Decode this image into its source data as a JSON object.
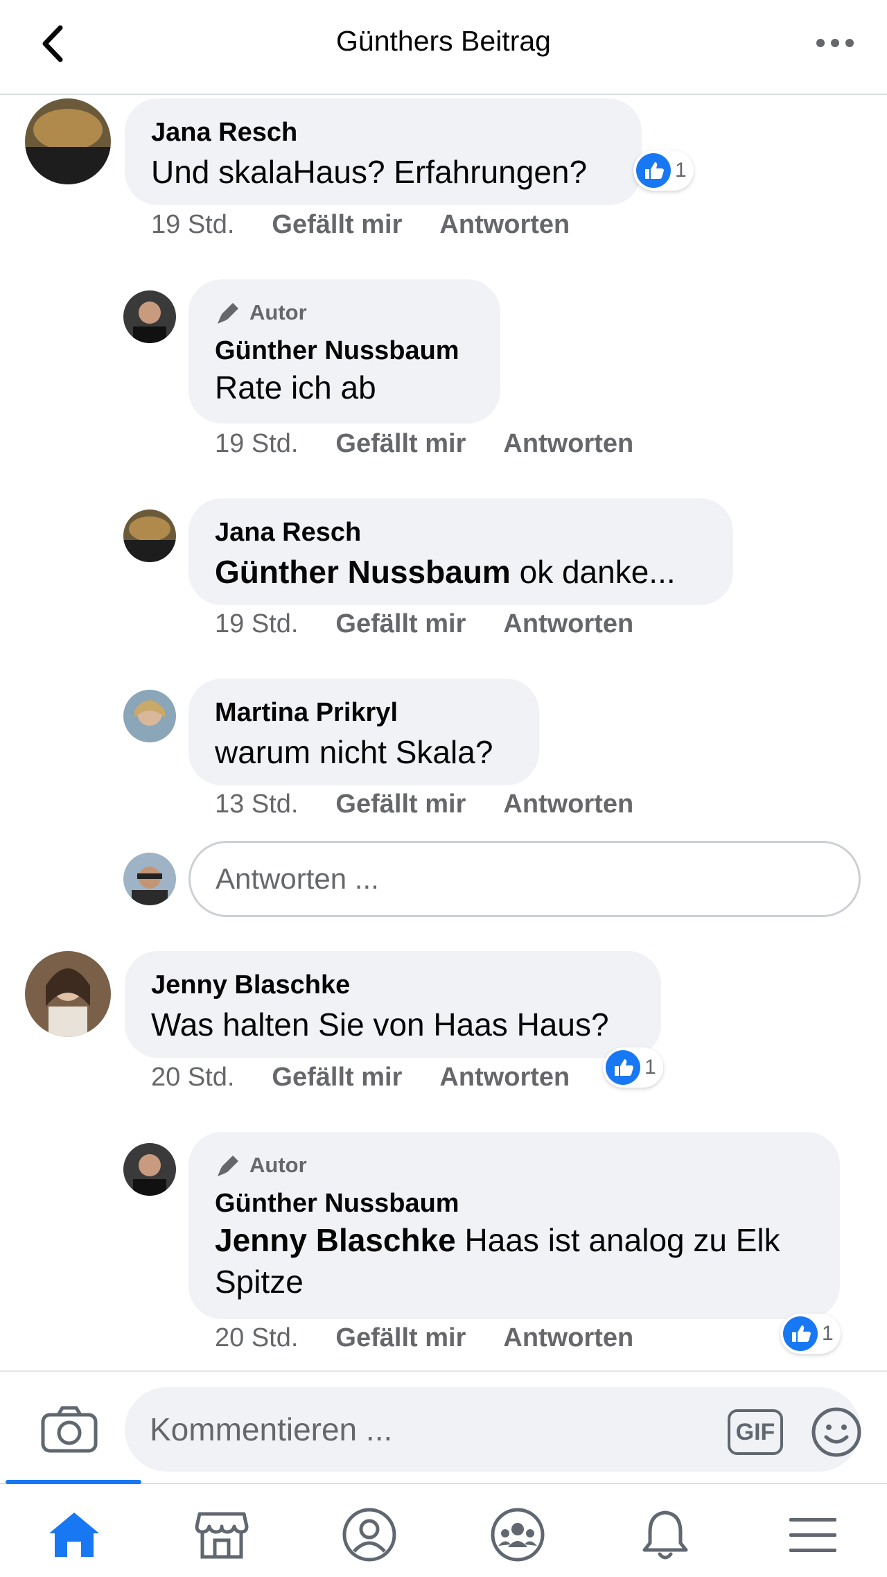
{
  "header": {
    "title": "Günthers Beitrag"
  },
  "comments": [
    {
      "name": "Jana Resch",
      "text": "Und skalaHaus? Erfahrungen?",
      "time": "19 Std.",
      "like_label": "Gefällt mir",
      "reply_label": "Antworten",
      "reaction_count": "1"
    },
    {
      "badge": "Autor",
      "name": "Günther Nussbaum",
      "text": "Rate ich ab",
      "time": "19 Std.",
      "like_label": "Gefällt mir",
      "reply_label": "Antworten"
    },
    {
      "name": "Jana Resch",
      "mention": "Günther Nussbaum",
      "text": " ok danke...",
      "time": "19 Std.",
      "like_label": "Gefällt mir",
      "reply_label": "Antworten"
    },
    {
      "name": "Martina Prikryl",
      "text": "warum nicht Skala?",
      "time": "13 Std.",
      "like_label": "Gefällt mir",
      "reply_label": "Antworten"
    },
    {
      "name": "Jenny Blaschke",
      "text": "Was halten Sie von Haas Haus?",
      "time": "20 Std.",
      "like_label": "Gefällt mir",
      "reply_label": "Antworten",
      "reaction_count": "1"
    },
    {
      "badge": "Autor",
      "name": "Günther Nussbaum",
      "mention": "Jenny Blaschke",
      "text": " Haas ist analog zu Elk",
      "text_line2": "Spitze",
      "time": "20 Std.",
      "like_label": "Gefällt mir",
      "reply_label": "Antworten",
      "reaction_count": "1"
    }
  ],
  "reply_input": {
    "placeholder": "Antworten ..."
  },
  "composer": {
    "placeholder": "Kommentieren ...",
    "gif_label": "GIF"
  },
  "colors": {
    "accent": "#1877f2",
    "bubble": "#f0f2f5",
    "secondary_text": "#65676b"
  },
  "tabs": [
    "home-icon",
    "marketplace-icon",
    "profile-icon",
    "groups-icon",
    "notifications-icon",
    "menu-icon"
  ]
}
